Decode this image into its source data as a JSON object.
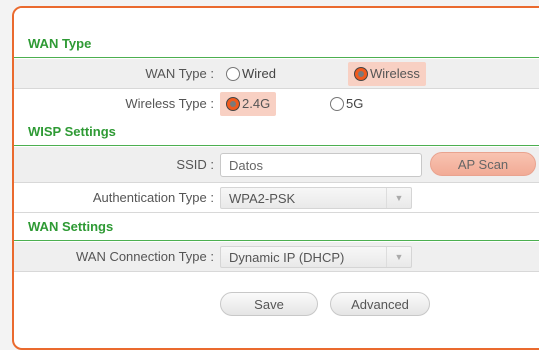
{
  "sections": {
    "wan_type": "WAN Type",
    "wisp_settings": "WISP Settings",
    "wan_settings": "WAN Settings"
  },
  "wan_type": {
    "label": "WAN Type :",
    "options": [
      "Wired",
      "Wireless"
    ],
    "selected": "Wireless"
  },
  "wireless_type": {
    "label": "Wireless Type :",
    "options": [
      "2.4G",
      "5G"
    ],
    "selected": "2.4G"
  },
  "ssid": {
    "label": "SSID :",
    "value": "Datos",
    "scan_button": "AP Scan"
  },
  "authentication": {
    "label": "Authentication Type :",
    "value": "WPA2-PSK"
  },
  "wan_connection": {
    "label": "WAN Connection Type :",
    "value": "Dynamic IP (DHCP)"
  },
  "buttons": {
    "save": "Save",
    "advanced": "Advanced"
  },
  "colors": {
    "accent": "#ea6a2e",
    "section_text": "#2e9a34",
    "selected_bg": "#f8d0c3"
  }
}
